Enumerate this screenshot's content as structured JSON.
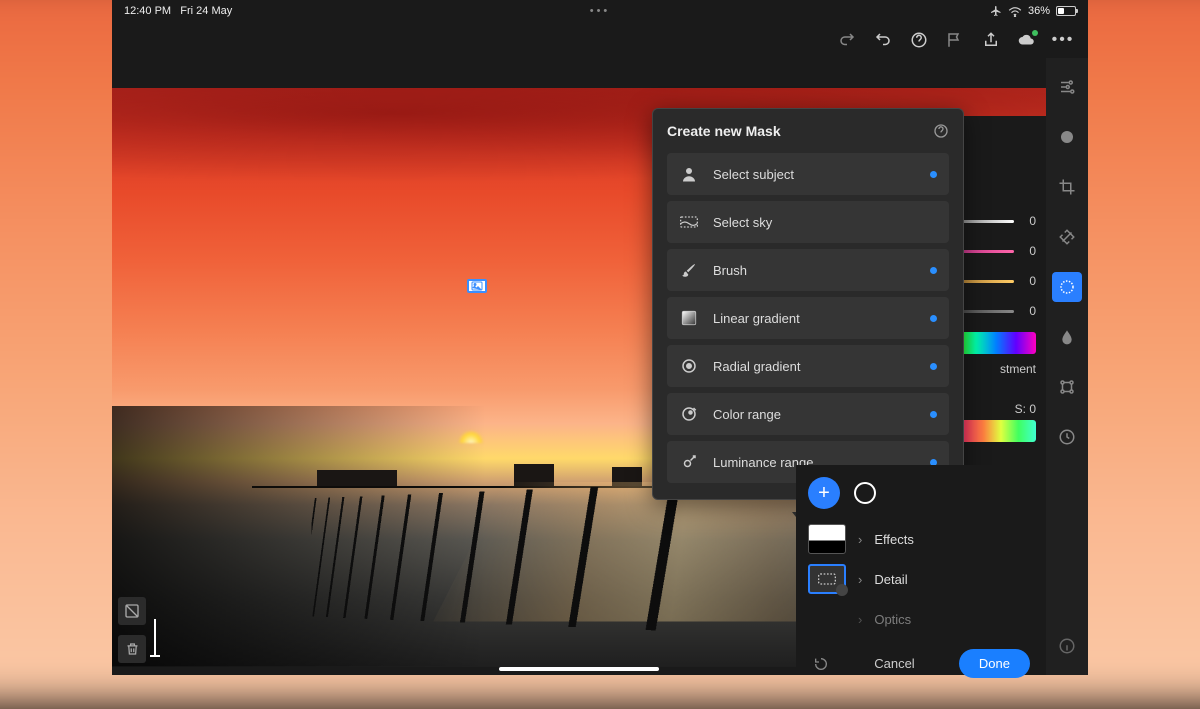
{
  "statusbar": {
    "time": "12:40 PM",
    "date": "Fri 24 May",
    "battery_pct": "36%"
  },
  "mask_panel": {
    "title": "Create new Mask",
    "items": [
      {
        "label": "Select subject",
        "icon": "person-icon",
        "dot": true
      },
      {
        "label": "Select sky",
        "icon": "sky-icon",
        "dot": false
      },
      {
        "label": "Brush",
        "icon": "brush-icon",
        "dot": true
      },
      {
        "label": "Linear gradient",
        "icon": "linear-gradient-icon",
        "dot": true
      },
      {
        "label": "Radial gradient",
        "icon": "radial-gradient-icon",
        "dot": true
      },
      {
        "label": "Color range",
        "icon": "color-range-icon",
        "dot": true
      },
      {
        "label": "Luminance range",
        "icon": "luminance-range-icon",
        "dot": true
      }
    ]
  },
  "sliders": {
    "values": [
      "0",
      "0",
      "0",
      "0"
    ],
    "label_partial": "stment",
    "s_label": "S: 0"
  },
  "mask_strip": {
    "rows": [
      {
        "label": "Effects"
      },
      {
        "label": "Detail"
      },
      {
        "label_partial": "Optics"
      }
    ]
  },
  "actions": {
    "cancel": "Cancel",
    "done": "Done"
  }
}
